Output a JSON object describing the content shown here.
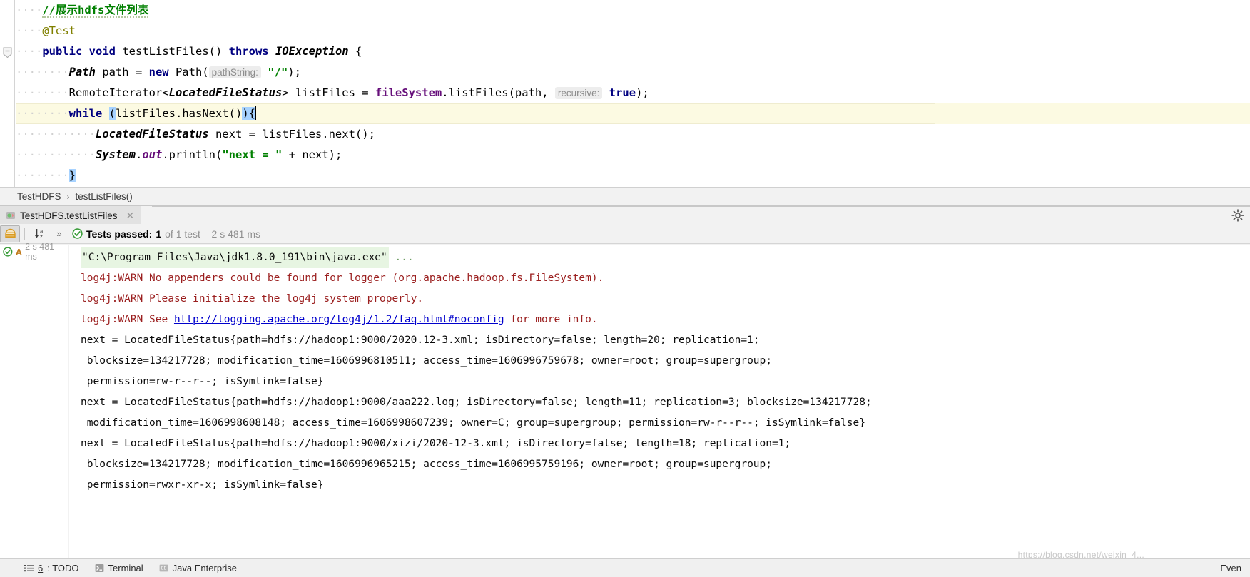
{
  "editor": {
    "lines": [
      {
        "indentDots": "····",
        "segments": [
          {
            "t": "//展示hdfs文件列表",
            "c": "cmt squiggle"
          }
        ]
      },
      {
        "indentDots": "····",
        "segments": [
          {
            "t": "@Test",
            "c": "anno"
          }
        ]
      },
      {
        "indentDots": "····",
        "segments": [
          {
            "t": "public",
            "c": "kw"
          },
          {
            "t": " ",
            "c": "plain"
          },
          {
            "t": "void",
            "c": "kw"
          },
          {
            "t": " testListFiles() ",
            "c": "plain"
          },
          {
            "t": "throws",
            "c": "kw"
          },
          {
            "t": " ",
            "c": "plain"
          },
          {
            "t": "IOException",
            "c": "cls-it"
          },
          {
            "t": " {",
            "c": "plain"
          }
        ]
      },
      {
        "indentDots": "········",
        "segments": [
          {
            "t": "Path",
            "c": "cls-it"
          },
          {
            "t": " path = ",
            "c": "plain"
          },
          {
            "t": "new",
            "c": "kw"
          },
          {
            "t": " Path(",
            "c": "plain"
          },
          {
            "t": "pathString:",
            "c": "hint"
          },
          {
            "t": " ",
            "c": "plain"
          },
          {
            "t": "\"/\"",
            "c": "str"
          },
          {
            "t": ");",
            "c": "plain"
          }
        ]
      },
      {
        "indentDots": "········",
        "segments": [
          {
            "t": "RemoteIterator<",
            "c": "plain"
          },
          {
            "t": "LocatedFileStatus",
            "c": "cls-it"
          },
          {
            "t": "> listFiles = ",
            "c": "plain"
          },
          {
            "t": "fileSystem",
            "c": "meth-hl"
          },
          {
            "t": ".listFiles(path, ",
            "c": "plain"
          },
          {
            "t": "recursive:",
            "c": "hint"
          },
          {
            "t": " ",
            "c": "plain"
          },
          {
            "t": "true",
            "c": "kw"
          },
          {
            "t": ");",
            "c": "plain"
          }
        ]
      },
      {
        "indentDots": "········",
        "caret": true,
        "segments": [
          {
            "t": "while",
            "c": "kw"
          },
          {
            "t": " ",
            "c": "plain"
          },
          {
            "t": "(",
            "c": "plain selblue"
          },
          {
            "t": "listFiles.hasNext()",
            "c": "plain"
          },
          {
            "t": ")",
            "c": "plain selblue"
          },
          {
            "t": "{",
            "c": "plain selblue"
          }
        ]
      },
      {
        "indentDots": "············",
        "segments": [
          {
            "t": "LocatedFileStatus",
            "c": "cls-it"
          },
          {
            "t": " next = listFiles.next();",
            "c": "plain"
          }
        ]
      },
      {
        "indentDots": "············",
        "segments": [
          {
            "t": "System",
            "c": "cls-it"
          },
          {
            "t": ".",
            "c": "plain"
          },
          {
            "t": "out",
            "c": "fld"
          },
          {
            "t": ".println(",
            "c": "plain"
          },
          {
            "t": "\"next = \"",
            "c": "str"
          },
          {
            "t": " + next);",
            "c": "plain"
          }
        ]
      },
      {
        "indentDots": "········",
        "segments": [
          {
            "t": "}",
            "c": "plain selblue"
          }
        ]
      }
    ]
  },
  "breadcrumb": {
    "class_name": "TestHDFS",
    "separator": "›",
    "method_name": "testListFiles()"
  },
  "run_tab": {
    "label": "TestHDFS.testListFiles",
    "close": "✕"
  },
  "results_toolbar": {
    "sort_icon": "sort-alphabetically-icon",
    "expand_icon": "»",
    "status_prefix": "Tests passed:",
    "status_count": "1",
    "status_suffix": "of 1 test – 2 s 481 ms"
  },
  "test_tree": {
    "rows": [
      {
        "status_icon": "passed-check-icon",
        "warn": "A",
        "time": "2 s 481 ms"
      }
    ]
  },
  "console": {
    "lines": [
      {
        "type": "cmd",
        "text": "\"C:\\Program Files\\Java\\jdk1.8.0_191\\bin\\java.exe\"",
        "ellipsis": " ..."
      },
      {
        "type": "warn",
        "text": "log4j:WARN No appenders could be found for logger (org.apache.hadoop.fs.FileSystem)."
      },
      {
        "type": "warn",
        "text": "log4j:WARN Please initialize the log4j system properly."
      },
      {
        "type": "warnlink",
        "pre": "log4j:WARN See ",
        "link": "http://logging.apache.org/log4j/1.2/faq.html#noconfig",
        "post": " for more info."
      },
      {
        "type": "out",
        "text": "next = LocatedFileStatus{path=hdfs://hadoop1:9000/2020.12-3.xml; isDirectory=false; length=20; replication=1;"
      },
      {
        "type": "out",
        "text": " blocksize=134217728; modification_time=1606996810511; access_time=1606996759678; owner=root; group=supergroup;"
      },
      {
        "type": "out",
        "text": " permission=rw-r--r--; isSymlink=false}"
      },
      {
        "type": "out",
        "text": "next = LocatedFileStatus{path=hdfs://hadoop1:9000/aaa222.log; isDirectory=false; length=11; replication=3; blocksize=134217728;"
      },
      {
        "type": "out",
        "text": " modification_time=1606998608148; access_time=1606998607239; owner=C; group=supergroup; permission=rw-r--r--; isSymlink=false}"
      },
      {
        "type": "out",
        "text": "next = LocatedFileStatus{path=hdfs://hadoop1:9000/xizi/2020-12-3.xml; isDirectory=false; length=18; replication=1;"
      },
      {
        "type": "out",
        "text": " blocksize=134217728; modification_time=1606996965215; access_time=1606995759196; owner=root; group=supergroup;"
      },
      {
        "type": "out",
        "text": " permission=rwxr-xr-x; isSymlink=false}"
      }
    ]
  },
  "statusbar": {
    "items": [
      {
        "icon": "todo-icon",
        "num": "6",
        "label": ": TODO"
      },
      {
        "icon": "terminal-icon",
        "num": "",
        "label": "Terminal"
      },
      {
        "icon": "java-enterprise-icon",
        "num": "",
        "label": "Java Enterprise"
      }
    ],
    "right_label": "Even"
  },
  "watermark": "https://blog.csdn.net/weixin_4..."
}
